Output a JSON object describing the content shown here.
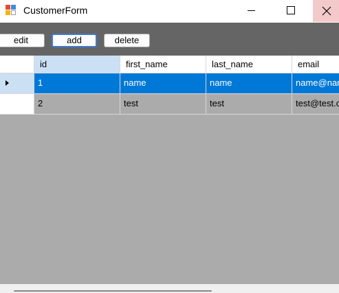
{
  "window": {
    "title": "CustomerForm",
    "icons": [
      "form-app-icon",
      "minimize-icon",
      "maximize-icon",
      "close-icon"
    ]
  },
  "toolbar": {
    "edit_label": "edit",
    "add_label": "add",
    "delete_label": "delete"
  },
  "grid": {
    "columns": [
      "id",
      "first_name",
      "last_name",
      "email"
    ],
    "rows": [
      {
        "id": "1",
        "first_name": "name",
        "last_name": "name",
        "email": "name@nar"
      },
      {
        "id": "2",
        "first_name": "test",
        "last_name": "test",
        "email": "test@test.c"
      }
    ],
    "selected_row": 1
  },
  "colors": {
    "toolbar_bg": "#656565",
    "grid_bg": "#ababab",
    "selection": "#0078d7",
    "header_highlight": "#cce0f4",
    "close_hover": "#f3c9c9"
  }
}
